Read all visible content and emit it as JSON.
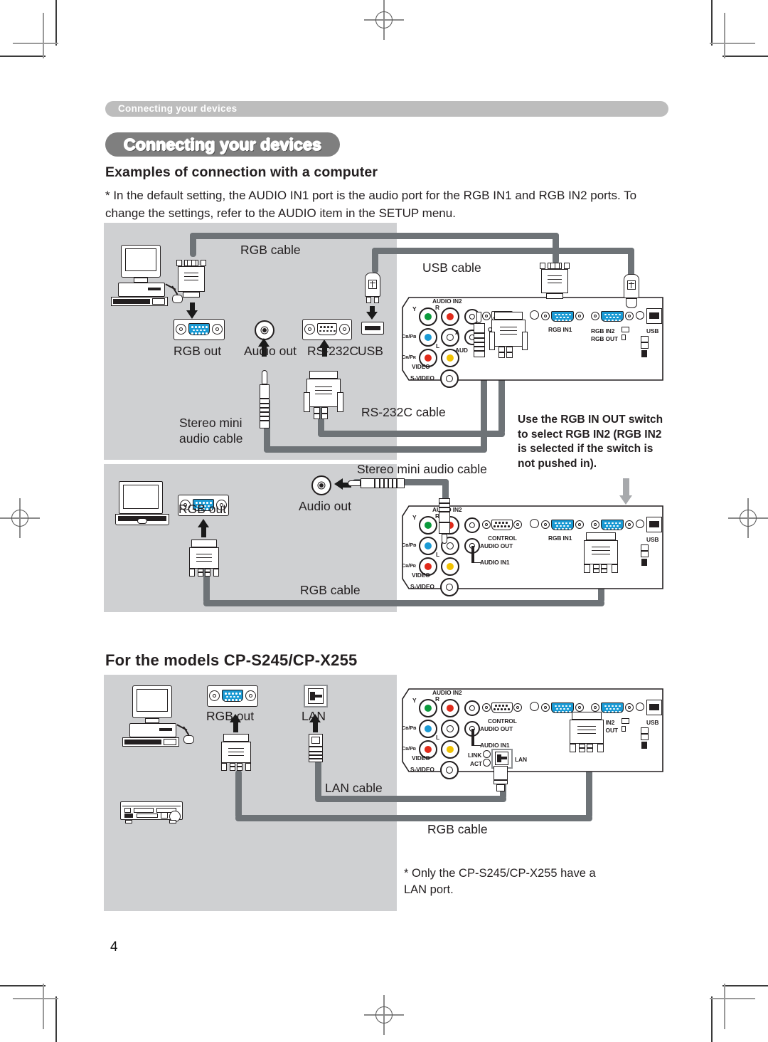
{
  "runhead": "Connecting your devices",
  "title": "Connecting your devices",
  "h2": "Examples of connection with a computer",
  "note": "* In the default setting, the AUDIO IN1 port is the audio port for the RGB IN1 and RGB IN2 ports. To change the settings, refer to the AUDIO item in the SETUP menu.",
  "h2b": "For the models CP-S245/CP-X255",
  "page_number": "4",
  "diagram1": {
    "labels": {
      "rgb_cable": "RGB cable",
      "usb_cable": "USB cable",
      "rgb_out": "RGB out",
      "audio_out": "Audio out",
      "rs232c": "RS-232C",
      "usb": "USB",
      "stereo_mini_audio_cable": "Stereo mini\naudio cable",
      "rs232c_cable": "RS-232C cable"
    },
    "callout": "Use the RGB IN OUT switch to select RGB IN2 (RGB IN2 is selected if the switch is not pushed in)."
  },
  "diagram2": {
    "labels": {
      "rgb_out": "RGB out",
      "audio_out": "Audio out",
      "stereo_mini_audio_cable": "Stereo mini audio cable",
      "rgb_cable": "RGB cable"
    }
  },
  "diagram3": {
    "labels": {
      "rgb_out": "RGB out",
      "lan": "LAN",
      "lan_cable": "LAN cable",
      "rgb_cable": "RGB cable"
    },
    "footnote": "* Only the CP-S245/CP-X255 have a\n   LAN port."
  },
  "projector_panel": {
    "audio_in2": "AUDIO IN2",
    "y": "Y",
    "r": "R",
    "l": "L",
    "cbpb": "Cʙ/Pʙ",
    "crpr": "Cʀ/Pʀ",
    "video": "VIDEO",
    "svideo": "S-VIDEO",
    "control": "CONTROL",
    "rgb_in1": "RGB IN1",
    "rgb_in2": "RGB IN2",
    "rgb_out": "RGB OUT",
    "usb": "USB",
    "audio_out": "AUDIO OUT",
    "audio_in1": "AUDIO IN1",
    "lan": "LAN",
    "link": "LINK",
    "act": "ACT"
  },
  "colors": {
    "panel_bg": "#cfd0d2",
    "runhead_bg": "#bdbdbd",
    "title_bg": "#7f7f7f",
    "cable": "#6e7377",
    "vga_blue": "#1a9ad4"
  }
}
